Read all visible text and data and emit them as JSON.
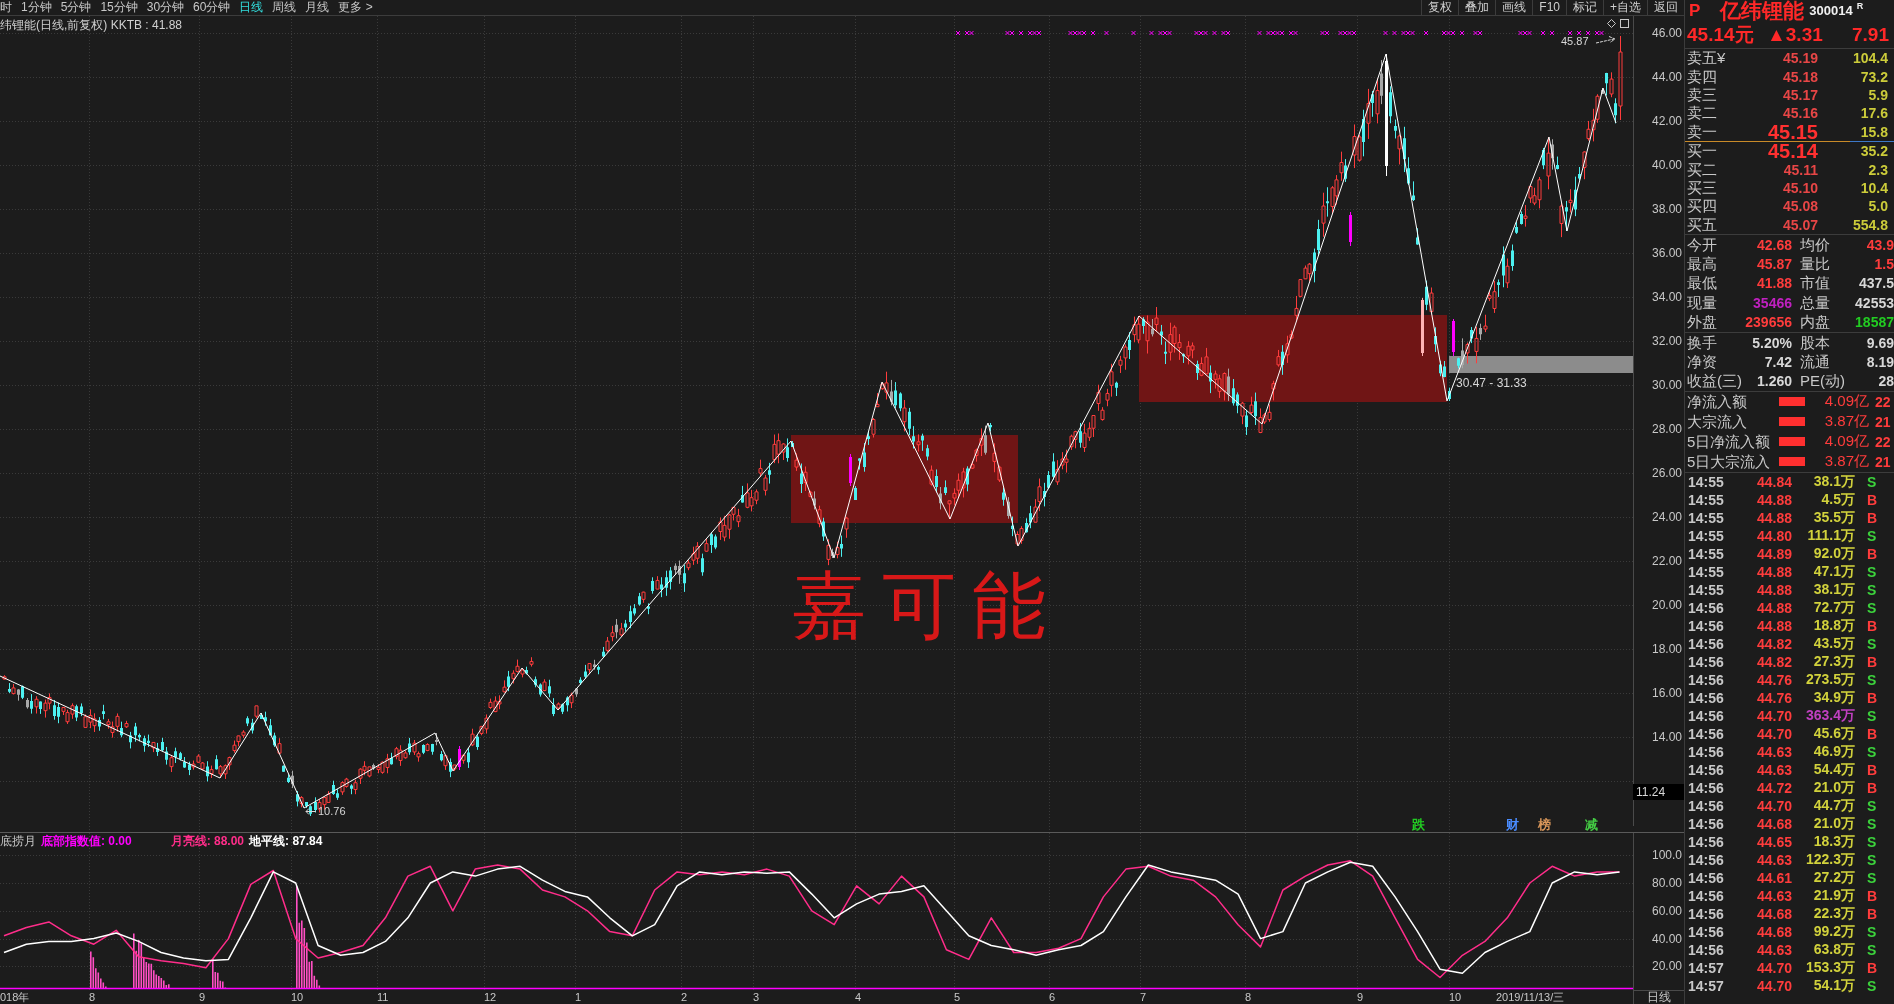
{
  "toolbar": {
    "periods": [
      {
        "label": "时",
        "selected": false
      },
      {
        "label": "1分钟",
        "selected": false
      },
      {
        "label": "5分钟",
        "selected": false
      },
      {
        "label": "15分钟",
        "selected": false
      },
      {
        "label": "30分钟",
        "selected": false
      },
      {
        "label": "60分钟",
        "selected": false
      },
      {
        "label": "日线",
        "selected": true
      },
      {
        "label": "周线",
        "selected": false
      },
      {
        "label": "月线",
        "selected": false
      },
      {
        "label": "更多 >",
        "selected": false
      }
    ],
    "buttons": [
      "复权",
      "叠加",
      "画线",
      "F10",
      "标记",
      "+自选",
      "返回"
    ]
  },
  "chart": {
    "title": "纬锂能(日线,前复权) KKTB : 41.88",
    "price_axis": [
      "46.00",
      "44.00",
      "42.00",
      "40.00",
      "38.00",
      "36.00",
      "34.00",
      "32.00",
      "30.00",
      "28.00",
      "26.00",
      "24.00",
      "22.00",
      "20.00",
      "18.00",
      "16.00",
      "14.00"
    ],
    "last_price_marker": "11.24",
    "annotations": [
      {
        "kind": "high",
        "text": "45.87"
      },
      {
        "kind": "range",
        "text": "30.47 - 31.33"
      },
      {
        "kind": "note",
        "text": "嘉可能"
      },
      {
        "kind": "low",
        "text": "10.76"
      }
    ],
    "events": [
      {
        "text": "跌",
        "color": "#22cc22"
      },
      {
        "text": "财",
        "color": "#4a8cff"
      },
      {
        "text": "榜",
        "color": "#d8965a"
      },
      {
        "text": "减",
        "color": "#44cc44"
      }
    ]
  },
  "indicator": {
    "name": "底捞月",
    "legends": [
      {
        "text": "底部指数值: 0.00",
        "color": "#ff00ff"
      },
      {
        "text": "月亮线: 88.00",
        "color": "#ff2d8a"
      },
      {
        "text": "地平线: 87.84",
        "color": "#ffffff"
      }
    ],
    "chart_data": {
      "type": "line",
      "grid": true,
      "ylim": [
        3,
        116
      ],
      "yticks": [
        {
          "value": 100,
          "label": "100.0"
        },
        {
          "value": 80,
          "label": "80.00"
        },
        {
          "value": 60,
          "label": "60.00"
        },
        {
          "value": 40,
          "label": "40.00"
        },
        {
          "value": 20,
          "label": "20.00"
        }
      ],
      "series": [
        {
          "color": "#ff2d8a",
          "values": [
            42,
            48,
            52,
            42,
            36,
            46,
            27,
            24,
            22,
            19,
            40,
            79,
            89,
            40,
            26,
            30,
            35,
            55,
            85,
            92,
            60,
            90,
            93,
            90,
            75,
            70,
            60,
            45,
            42,
            75,
            88,
            86,
            88,
            86,
            90,
            85,
            60,
            50,
            78,
            65,
            85,
            70,
            32,
            25,
            55,
            30,
            30,
            33,
            40,
            70,
            90,
            92,
            85,
            82,
            70,
            50,
            34,
            75,
            85,
            93,
            96,
            85,
            55,
            25,
            12,
            28,
            38,
            55,
            80,
            92,
            85,
            88,
            88
          ]
        },
        {
          "color": "#ffffff",
          "values": [
            30,
            36,
            38,
            38,
            40,
            44,
            38,
            30,
            26,
            24,
            25,
            55,
            88,
            80,
            35,
            28,
            30,
            38,
            55,
            80,
            88,
            85,
            90,
            92,
            82,
            74,
            70,
            55,
            42,
            50,
            78,
            88,
            86,
            88,
            87,
            88,
            72,
            55,
            65,
            72,
            74,
            78,
            60,
            42,
            35,
            32,
            28,
            32,
            35,
            45,
            70,
            93,
            88,
            85,
            82,
            72,
            40,
            45,
            80,
            88,
            95,
            92,
            70,
            45,
            18,
            15,
            30,
            38,
            45,
            80,
            88,
            86,
            88
          ]
        }
      ]
    }
  },
  "date_axis": {
    "labels": [
      "018年",
      "8",
      "9",
      "10",
      "11",
      "12",
      "1",
      "2",
      "3",
      "4",
      "5",
      "6",
      "7",
      "8",
      "9",
      "10",
      "2019/11/13/三"
    ],
    "period": "日线"
  },
  "quote": {
    "flag": "P",
    "name": "亿纬锂能",
    "code": "300014",
    "mark": "R",
    "price": "45.14元",
    "change": "▲3.31",
    "percent": "7.91",
    "asks": [
      {
        "label": "卖五¥",
        "price": "45.19",
        "volume": "104.4",
        "best": false
      },
      {
        "label": "卖四",
        "price": "45.18",
        "volume": "73.2",
        "best": false
      },
      {
        "label": "卖三",
        "price": "45.17",
        "volume": "5.9",
        "best": false
      },
      {
        "label": "卖二",
        "price": "45.16",
        "volume": "17.6",
        "best": false
      },
      {
        "label": "卖一",
        "price": "45.15",
        "volume": "15.8",
        "best": true
      }
    ],
    "bids": [
      {
        "label": "买一",
        "price": "45.14",
        "volume": "35.2",
        "best": true
      },
      {
        "label": "买二",
        "price": "45.11",
        "volume": "2.3",
        "best": false
      },
      {
        "label": "买三",
        "price": "45.10",
        "volume": "10.4",
        "best": false
      },
      {
        "label": "买四",
        "price": "45.08",
        "volume": "5.0",
        "best": false
      },
      {
        "label": "买五",
        "price": "45.07",
        "volume": "554.8",
        "best": false
      }
    ],
    "stats": [
      {
        "label": "今开",
        "value": "42.68",
        "color": "#ff3c3c"
      },
      {
        "label": "均价",
        "value": "43.9",
        "color": "#ff3c3c"
      },
      {
        "label": "最高",
        "value": "45.87",
        "color": "#ff3c3c"
      },
      {
        "label": "量比",
        "value": "1.5",
        "color": "#ff3c3c"
      },
      {
        "label": "最低",
        "value": "41.88",
        "color": "#ff3c3c"
      },
      {
        "label": "市值",
        "value": "437.5",
        "color": "#d8d8d8"
      },
      {
        "label": "现量",
        "value": "35466",
        "color": "#c020c0"
      },
      {
        "label": "总量",
        "value": "42553",
        "color": "#d8d8d8"
      },
      {
        "label": "外盘",
        "value": "239656",
        "color": "#ff3c3c"
      },
      {
        "label": "内盘",
        "value": "18587",
        "color": "#22cc22"
      }
    ],
    "fundamentals": [
      {
        "label": "换手",
        "value": "5.20%"
      },
      {
        "label": "股本",
        "value": "9.69"
      },
      {
        "label": "净资",
        "value": "7.42"
      },
      {
        "label": "流通",
        "value": "8.19"
      },
      {
        "label": "收益(三)",
        "value": "1.260"
      },
      {
        "label": "PE(动)",
        "value": "28"
      }
    ],
    "flows": [
      {
        "label": "净流入额",
        "value": "4.09亿",
        "column_4": "22"
      },
      {
        "label": "大宗流入",
        "value": "3.87亿",
        "column_4": "21"
      },
      {
        "label": "5日净流入额",
        "value": "4.09亿",
        "column_4": "22"
      },
      {
        "label": "5日大宗流入",
        "value": "3.87亿",
        "column_4": "21"
      }
    ],
    "trades": [
      {
        "time": "14:55",
        "price": "44.84",
        "volume": "38.1万",
        "side": "S",
        "kind": "sell",
        "large": false
      },
      {
        "time": "14:55",
        "price": "44.88",
        "volume": "4.5万",
        "side": "B",
        "kind": "buy",
        "large": false
      },
      {
        "time": "14:55",
        "price": "44.88",
        "volume": "35.5万",
        "side": "B",
        "kind": "buy",
        "large": false
      },
      {
        "time": "14:55",
        "price": "44.80",
        "volume": "111.1万",
        "side": "S",
        "kind": "sell",
        "large": false
      },
      {
        "time": "14:55",
        "price": "44.89",
        "volume": "92.0万",
        "side": "B",
        "kind": "buy",
        "large": false
      },
      {
        "time": "14:55",
        "price": "44.88",
        "volume": "47.1万",
        "side": "S",
        "kind": "sell",
        "large": false
      },
      {
        "time": "14:55",
        "price": "44.88",
        "volume": "38.1万",
        "side": "S",
        "kind": "sell",
        "large": false
      },
      {
        "time": "14:56",
        "price": "44.88",
        "volume": "72.7万",
        "side": "S",
        "kind": "sell",
        "large": false
      },
      {
        "time": "14:56",
        "price": "44.88",
        "volume": "18.8万",
        "side": "B",
        "kind": "buy",
        "large": false
      },
      {
        "time": "14:56",
        "price": "44.82",
        "volume": "43.5万",
        "side": "S",
        "kind": "sell",
        "large": false
      },
      {
        "time": "14:56",
        "price": "44.82",
        "volume": "27.3万",
        "side": "B",
        "kind": "buy",
        "large": false
      },
      {
        "time": "14:56",
        "price": "44.76",
        "volume": "273.5万",
        "side": "S",
        "kind": "sell",
        "large": false
      },
      {
        "time": "14:56",
        "price": "44.76",
        "volume": "34.9万",
        "side": "B",
        "kind": "buy",
        "large": false
      },
      {
        "time": "14:56",
        "price": "44.70",
        "volume": "363.4万",
        "side": "S",
        "kind": "sell",
        "large": true
      },
      {
        "time": "14:56",
        "price": "44.70",
        "volume": "45.6万",
        "side": "B",
        "kind": "buy",
        "large": false
      },
      {
        "time": "14:56",
        "price": "44.63",
        "volume": "46.9万",
        "side": "S",
        "kind": "sell",
        "large": false
      },
      {
        "time": "14:56",
        "price": "44.63",
        "volume": "54.4万",
        "side": "B",
        "kind": "buy",
        "large": false
      },
      {
        "time": "14:56",
        "price": "44.72",
        "volume": "21.0万",
        "side": "B",
        "kind": "buy",
        "large": false
      },
      {
        "time": "14:56",
        "price": "44.70",
        "volume": "44.7万",
        "side": "S",
        "kind": "sell",
        "large": false
      },
      {
        "time": "14:56",
        "price": "44.68",
        "volume": "21.0万",
        "side": "S",
        "kind": "sell",
        "large": false
      },
      {
        "time": "14:56",
        "price": "44.65",
        "volume": "18.3万",
        "side": "S",
        "kind": "sell",
        "large": false
      },
      {
        "time": "14:56",
        "price": "44.63",
        "volume": "122.3万",
        "side": "S",
        "kind": "sell",
        "large": false
      },
      {
        "time": "14:56",
        "price": "44.61",
        "volume": "27.2万",
        "side": "S",
        "kind": "sell",
        "large": false
      },
      {
        "time": "14:56",
        "price": "44.63",
        "volume": "21.9万",
        "side": "B",
        "kind": "buy",
        "large": false
      },
      {
        "time": "14:56",
        "price": "44.68",
        "volume": "22.3万",
        "side": "B",
        "kind": "buy",
        "large": false
      },
      {
        "time": "14:56",
        "price": "44.68",
        "volume": "99.2万",
        "side": "S",
        "kind": "sell",
        "large": false
      },
      {
        "time": "14:56",
        "price": "44.63",
        "volume": "63.8万",
        "side": "S",
        "kind": "sell",
        "large": false
      },
      {
        "time": "14:57",
        "price": "44.70",
        "volume": "153.3万",
        "side": "B",
        "kind": "buy",
        "large": false
      },
      {
        "time": "14:57",
        "price": "44.70",
        "volume": "54.1万",
        "side": "S",
        "kind": "sell",
        "large": false
      }
    ]
  }
}
